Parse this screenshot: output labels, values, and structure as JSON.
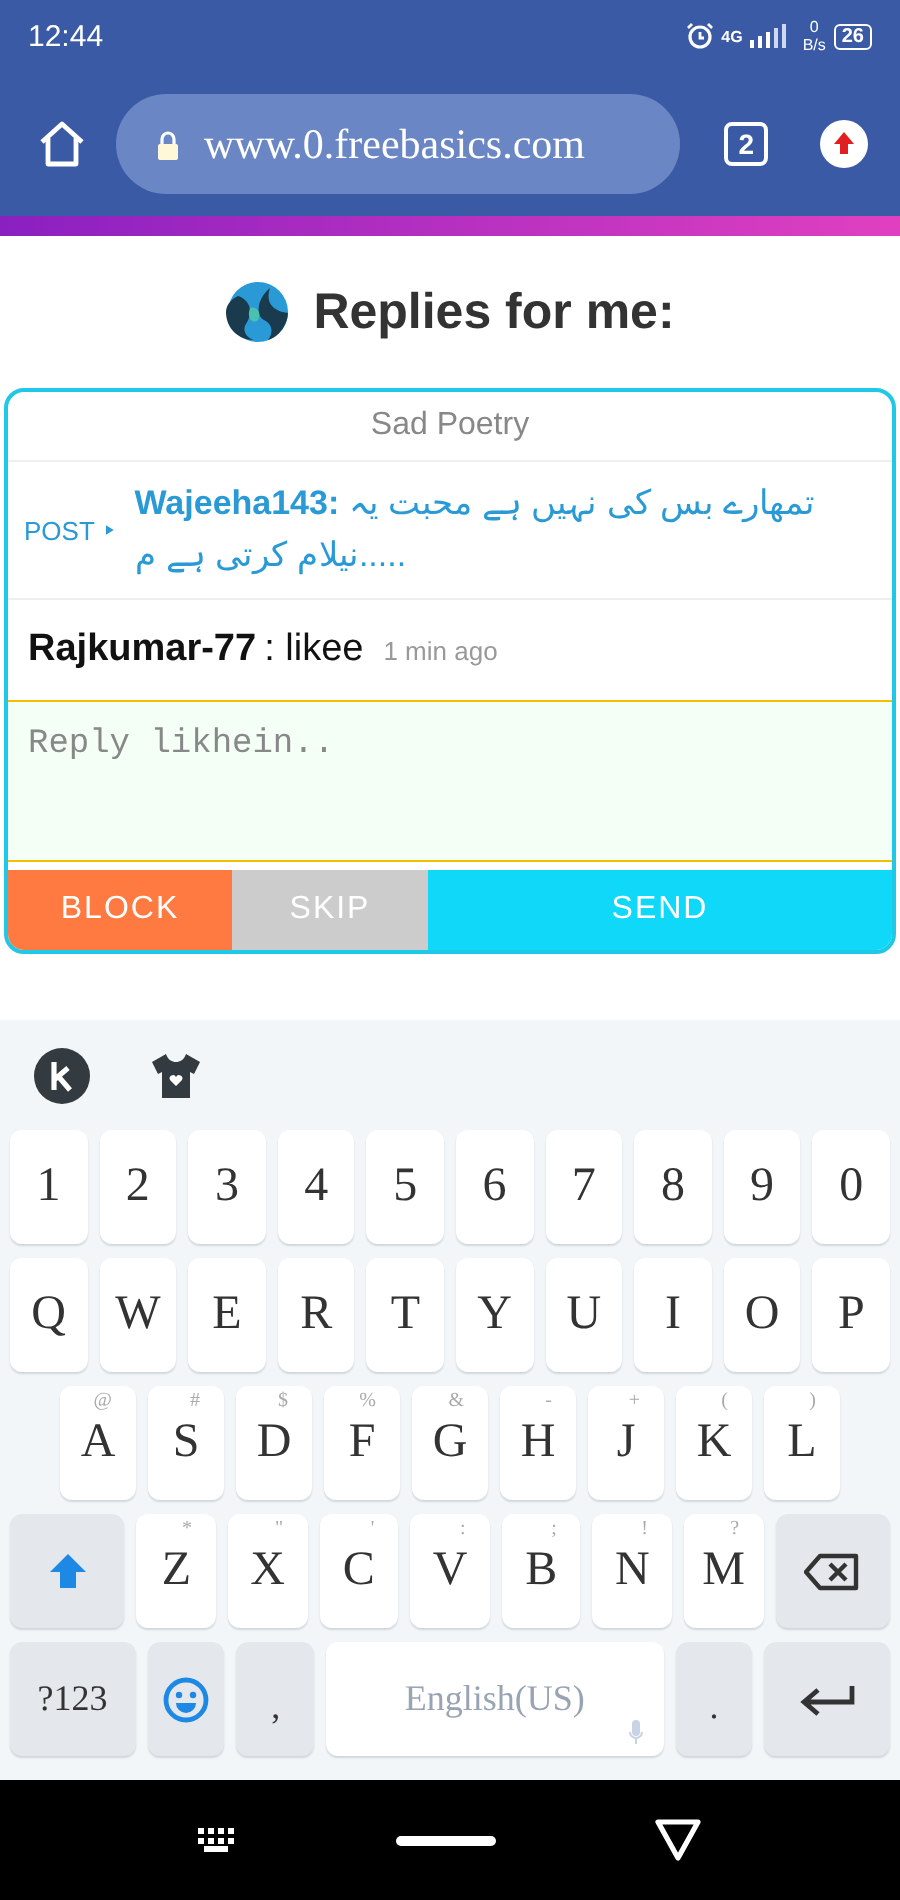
{
  "status_bar": {
    "time": "12:44",
    "network": "4G",
    "speed_value": "0",
    "speed_unit": "B/s",
    "battery": "26"
  },
  "browser": {
    "url": "www.0.freebasics.com",
    "tab_count": "2"
  },
  "page_title": "Replies for me:",
  "card": {
    "category": "Sad Poetry",
    "post": {
      "label": "POST",
      "author": "Wajeeha143:",
      "text": "تمھارے بس کی نہیں ہے محبت یہ نیلام کرتی ہے م....."
    },
    "reply": {
      "author": "Rajkumar-77",
      "text": ": likee",
      "time": "1 min ago"
    },
    "input": {
      "placeholder": "Reply likhein.."
    },
    "buttons": [
      {
        "label": "BLOCK",
        "kind": "block"
      },
      {
        "label": "SKIP",
        "kind": "skip"
      },
      {
        "label": "SEND",
        "kind": "send"
      }
    ]
  },
  "keyboard": {
    "rows": [
      {
        "keys": [
          {
            "kind": "key",
            "label": "1"
          },
          {
            "kind": "key",
            "label": "2"
          },
          {
            "kind": "key",
            "label": "3"
          },
          {
            "kind": "key",
            "label": "4"
          },
          {
            "kind": "key",
            "label": "5"
          },
          {
            "kind": "key",
            "label": "6"
          },
          {
            "kind": "key",
            "label": "7"
          },
          {
            "kind": "key",
            "label": "8"
          },
          {
            "kind": "key",
            "label": "9"
          },
          {
            "kind": "key",
            "label": "0"
          }
        ]
      },
      {
        "keys": [
          {
            "kind": "key",
            "label": "Q"
          },
          {
            "kind": "key",
            "label": "W"
          },
          {
            "kind": "key",
            "label": "E"
          },
          {
            "kind": "key",
            "label": "R"
          },
          {
            "kind": "key",
            "label": "T"
          },
          {
            "kind": "key",
            "label": "Y"
          },
          {
            "kind": "key",
            "label": "U"
          },
          {
            "kind": "key",
            "label": "I"
          },
          {
            "kind": "key",
            "label": "O"
          },
          {
            "kind": "key",
            "label": "P"
          }
        ]
      },
      {
        "keys": [
          {
            "kind": "key",
            "label": "A",
            "hint": "@"
          },
          {
            "kind": "key",
            "label": "S",
            "hint": "#"
          },
          {
            "kind": "key",
            "label": "D",
            "hint": "$"
          },
          {
            "kind": "key",
            "label": "F",
            "hint": "%"
          },
          {
            "kind": "key",
            "label": "G",
            "hint": "&"
          },
          {
            "kind": "key",
            "label": "H",
            "hint": "-"
          },
          {
            "kind": "key",
            "label": "J",
            "hint": "+"
          },
          {
            "kind": "key",
            "label": "K",
            "hint": "("
          },
          {
            "kind": "key",
            "label": "L",
            "hint": ")"
          }
        ]
      },
      {
        "keys": [
          {
            "kind": "shift"
          },
          {
            "kind": "key",
            "label": "Z",
            "hint": "*"
          },
          {
            "kind": "key",
            "label": "X",
            "hint": "\""
          },
          {
            "kind": "key",
            "label": "C",
            "hint": "'"
          },
          {
            "kind": "key",
            "label": "V",
            "hint": ":"
          },
          {
            "kind": "key",
            "label": "B",
            "hint": ";"
          },
          {
            "kind": "key",
            "label": "N",
            "hint": "!"
          },
          {
            "kind": "key",
            "label": "M",
            "hint": "?"
          },
          {
            "kind": "backspace"
          }
        ]
      },
      {
        "keys": [
          {
            "kind": "mode",
            "label": "?123"
          },
          {
            "kind": "emoji"
          },
          {
            "kind": "punct",
            "label": ","
          },
          {
            "kind": "space",
            "label": "English(US)"
          },
          {
            "kind": "punct",
            "label": "."
          },
          {
            "kind": "enter"
          }
        ]
      }
    ]
  }
}
